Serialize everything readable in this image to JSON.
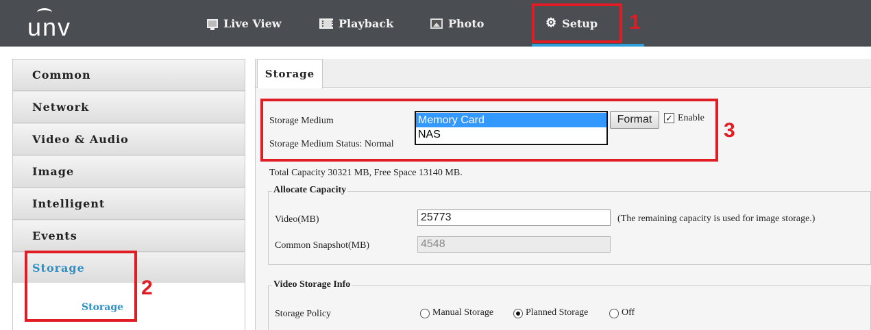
{
  "app": {
    "logo_text": "unv"
  },
  "nav": {
    "items": [
      {
        "label": "Live View",
        "icon": "monitor-icon"
      },
      {
        "label": "Playback",
        "icon": "film-icon"
      },
      {
        "label": "Photo",
        "icon": "photo-icon"
      },
      {
        "label": "Setup",
        "icon": "gear-icon",
        "active": true
      }
    ],
    "active_color": "#2e9fd9"
  },
  "annotations": {
    "color": "#e01c24",
    "labels": [
      "1",
      "2",
      "3"
    ]
  },
  "sidebar": {
    "items": [
      {
        "label": "Common"
      },
      {
        "label": "Network"
      },
      {
        "label": "Video & Audio"
      },
      {
        "label": "Image"
      },
      {
        "label": "Intelligent"
      },
      {
        "label": "Events"
      },
      {
        "label": "Storage",
        "active": true
      }
    ],
    "sub_items": [
      {
        "label": "Storage",
        "active": true
      }
    ],
    "active_color": "#2e8fc6"
  },
  "main": {
    "tab": "Storage",
    "storage_medium_label": "Storage Medium",
    "storage_medium_options": [
      "Memory Card",
      "NAS"
    ],
    "storage_medium_selected": "Memory Card",
    "format_button": "Format",
    "enable_label": "Enable",
    "enable_checked": true,
    "status_label": "Storage Medium Status:",
    "status_value": "Normal",
    "capacity_text": "Total Capacity 30321 MB, Free Space 13140 MB.",
    "allocate": {
      "legend": "Allocate Capacity",
      "video_label": "Video(MB)",
      "video_value": "25773",
      "video_note": "(The remaining capacity is used for image storage.)",
      "snapshot_label": "Common Snapshot(MB)",
      "snapshot_value": "4548"
    },
    "video_storage_info": {
      "legend": "Video Storage Info",
      "policy_label": "Storage Policy",
      "policy_options": [
        "Manual Storage",
        "Planned Storage",
        "Off"
      ],
      "policy_selected": "Planned Storage"
    }
  }
}
